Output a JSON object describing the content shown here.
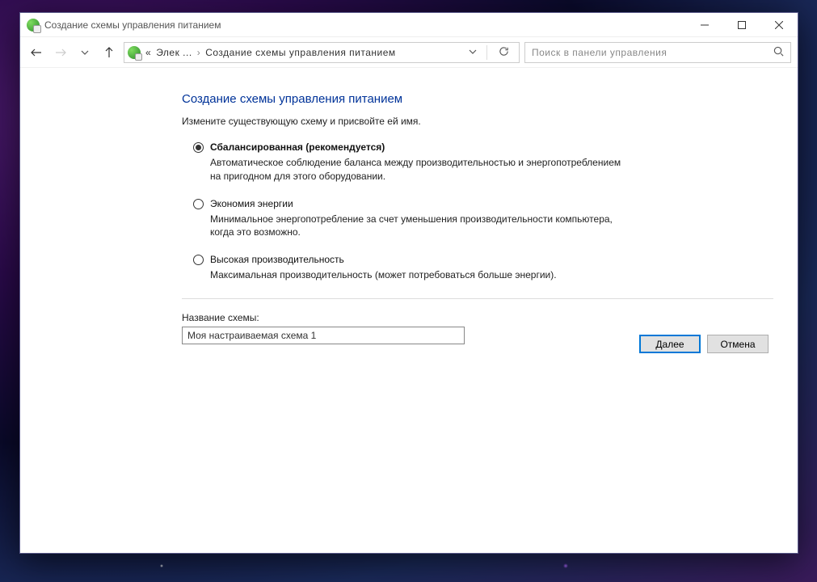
{
  "titlebar": {
    "title": "Создание схемы управления питанием"
  },
  "address": {
    "crumb_prefix": "«",
    "crumb1": "Элек ...",
    "crumb2": "Создание схемы управления питанием"
  },
  "search": {
    "placeholder": "Поиск в панели управления"
  },
  "page": {
    "title": "Создание схемы управления питанием",
    "subtitle": "Измените существующую схему и присвойте ей имя."
  },
  "plans": [
    {
      "name": "Сбалансированная (рекомендуется)",
      "desc": "Автоматическое соблюдение баланса между производительностью и энергопотреблением на пригодном для этого оборудовании.",
      "checked": true
    },
    {
      "name": "Экономия энергии",
      "desc": "Минимальное энергопотребление за счет уменьшения производительности компьютера, когда это возможно.",
      "checked": false
    },
    {
      "name": "Высокая производительность",
      "desc": "Максимальная производительность (может потребоваться больше энергии).",
      "checked": false
    }
  ],
  "field": {
    "label": "Название схемы:",
    "value": "Моя настраиваемая схема 1"
  },
  "buttons": {
    "next": "Далее",
    "cancel": "Отмена"
  }
}
